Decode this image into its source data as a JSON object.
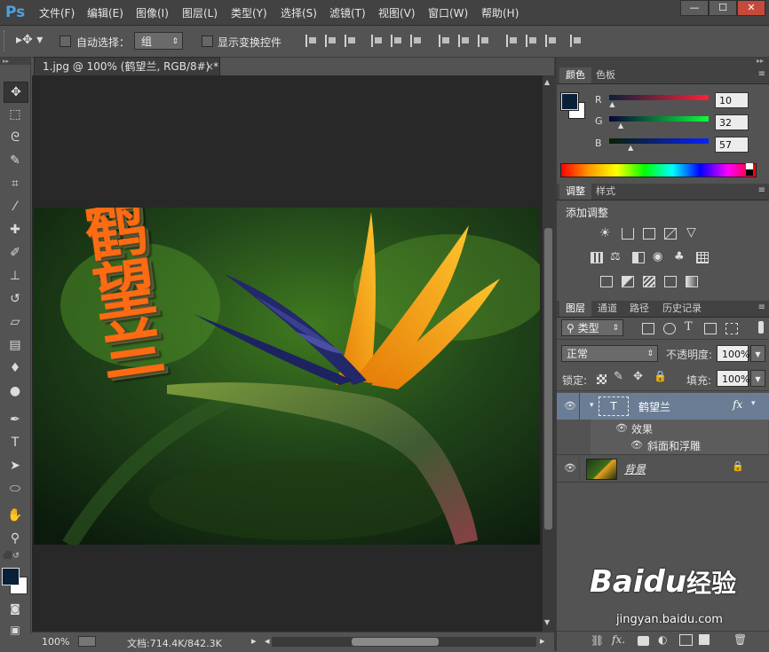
{
  "app": {
    "logo": "Ps",
    "menus": [
      "文件(F)",
      "编辑(E)",
      "图像(I)",
      "图层(L)",
      "类型(Y)",
      "选择(S)",
      "滤镜(T)",
      "视图(V)",
      "窗口(W)",
      "帮助(H)"
    ],
    "window_buttons": [
      "—",
      "☐",
      "✕"
    ]
  },
  "options": {
    "auto_select_label": "自动选择：",
    "auto_select_value": "组",
    "show_transform_label": "显示变换控件"
  },
  "document": {
    "tab_title": "1.jpg @ 100% (鹤望兰, RGB/8#) *",
    "tab_close": "×",
    "zoom": "100%",
    "doc_size": "文档:714.4K/842.3K",
    "overlay_text": "鹤望兰"
  },
  "color_panel": {
    "tabs": [
      "颜色",
      "色板"
    ],
    "channels": [
      {
        "name": "R",
        "value": "10",
        "level": 0.039
      },
      {
        "name": "G",
        "value": "32",
        "level": 0.125
      },
      {
        "name": "B",
        "value": "57",
        "level": 0.224
      }
    ],
    "foreground": "#0a2039"
  },
  "adjust_panel": {
    "tabs": [
      "调整",
      "样式"
    ],
    "title": "添加调整"
  },
  "layers_panel": {
    "tabs": [
      "图层",
      "通道",
      "路径",
      "历史记录"
    ],
    "filter_value": "类型",
    "blend_mode": "正常",
    "opacity_label": "不透明度:",
    "opacity_value": "100%",
    "lock_label": "锁定:",
    "fill_label": "填充:",
    "fill_value": "100%",
    "layers": [
      {
        "name": "鹤望兰",
        "fx": "fx",
        "effects_label": "效果",
        "effect_item": "斜面和浮雕"
      },
      {
        "name": "背景"
      }
    ]
  },
  "watermark": {
    "brand": "Baidu",
    "brand_cn": "经验",
    "url": "jingyan.baidu.com"
  }
}
